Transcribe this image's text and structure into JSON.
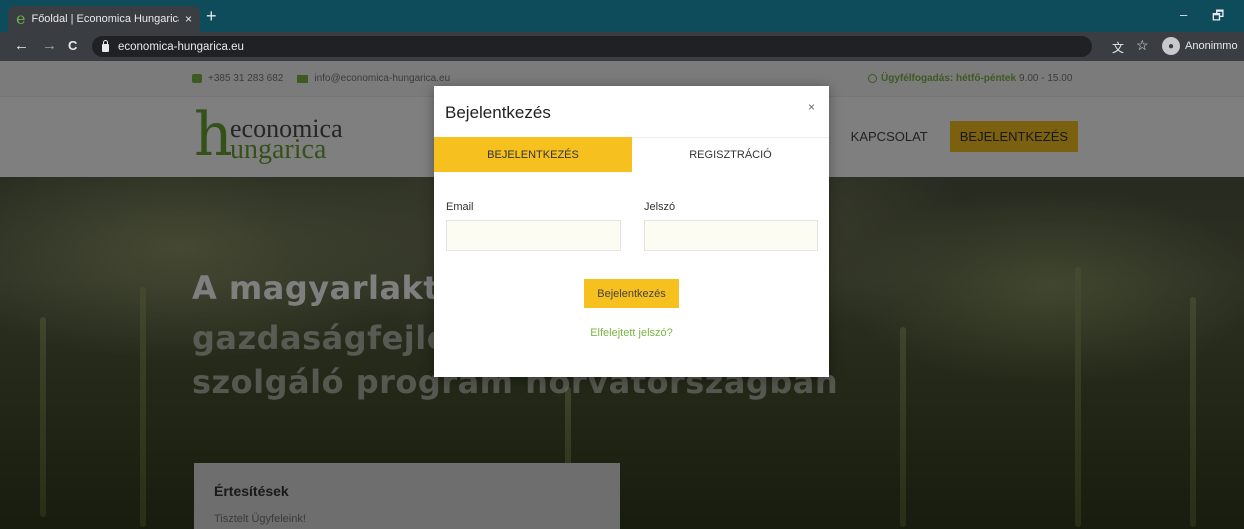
{
  "browser": {
    "tab_title": "Főoldal | Economica Hungarica",
    "tab_close": "×",
    "new_tab": "+",
    "url": "economica-hungarica.eu",
    "profile_name": "Anonimmo",
    "nav_back": "←",
    "nav_forward": "→",
    "nav_reload": "C",
    "minimize": "–",
    "restore": "🗗",
    "star": "☆",
    "translate": "文"
  },
  "site": {
    "phone": "+385 31 283 682",
    "email": "info@economica-hungarica.eu",
    "hours_label": "Ügyfélfogadás: hétfő-péntek",
    "hours_value": "9.00 - 15.00",
    "logo_letter": "h",
    "logo_line1": "economica",
    "logo_line2": "ungarica",
    "nav_partial": "K",
    "nav_contact": "KAPCSOLAT",
    "nav_login": "BEJELENTKEZÉS",
    "hero_line1": "A magyarlakta",
    "hero_line2": "gazdaságfejle",
    "hero_line3": "szolgáló program horvátországban",
    "notice_title": "Értesítések",
    "notice_text": "Tisztelt Ügyfeleink!"
  },
  "modal": {
    "title": "Bejelentkezés",
    "close": "×",
    "tab_login": "BEJELENTKEZÉS",
    "tab_register": "REGISZTRÁCIÓ",
    "email_label": "Email",
    "password_label": "Jelszó",
    "email_value": "",
    "password_value": "",
    "submit_label": "Bejelentkezés",
    "forgot_label": "Elfelejtett jelszó?"
  },
  "colors": {
    "accent_yellow": "#f6c11e",
    "brand_green": "#7cb342",
    "browser_frame": "#0e4c5c"
  }
}
